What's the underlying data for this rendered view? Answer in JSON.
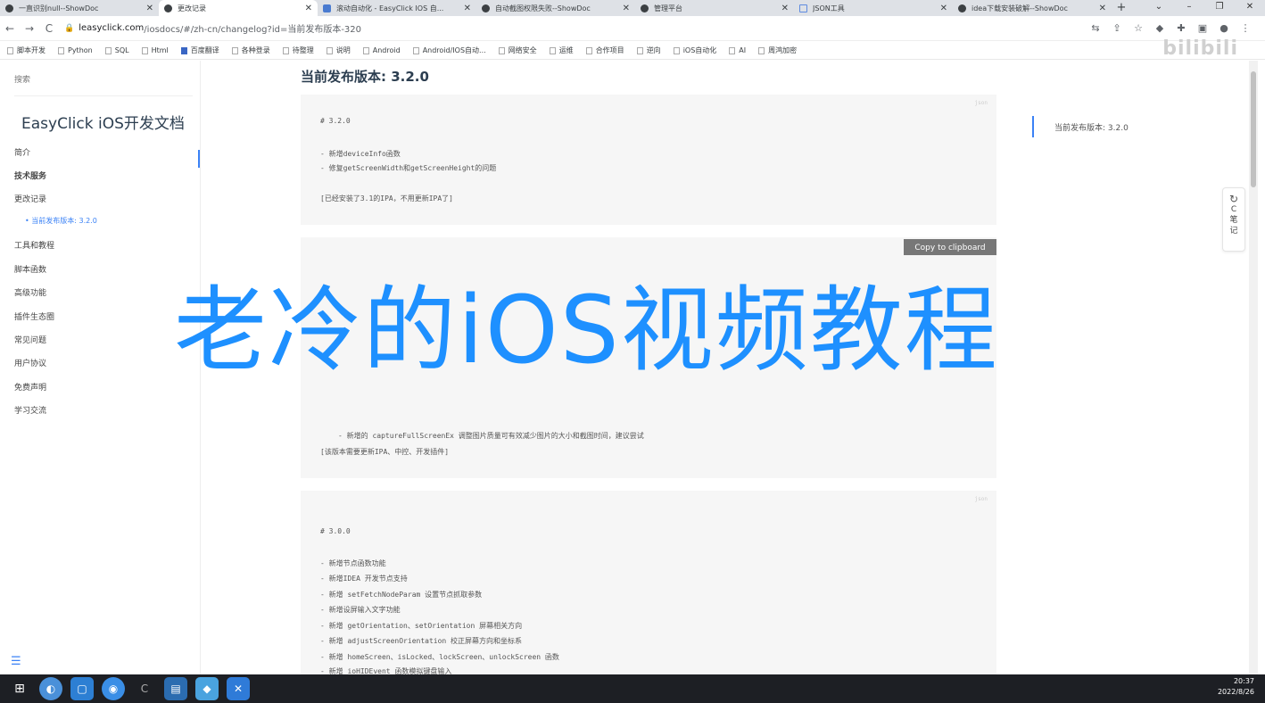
{
  "browser": {
    "tabs": [
      {
        "title": "一直识别null--ShowDoc",
        "icon": "showdoc-icon"
      },
      {
        "title": "更改记录",
        "icon": "showdoc-icon",
        "active": true
      },
      {
        "title": "滚动自动化 - EasyClick IOS 自...",
        "icon": "easyclick-icon"
      },
      {
        "title": "自动截图权限失败--ShowDoc",
        "icon": "showdoc-icon"
      },
      {
        "title": "管理平台",
        "icon": "showdoc-icon"
      },
      {
        "title": "JSON工具",
        "icon": "json-icon"
      },
      {
        "title": "idea下载安装破解--ShowDoc",
        "icon": "showdoc-icon"
      }
    ],
    "new_tab": "+",
    "url_host": "leasyclick.com",
    "url_path": "/iosdocs/#/zh-cn/changelog?id=当前发布版本-320",
    "bookmarks": [
      "脚本开发",
      "Python",
      "SQL",
      "Html",
      "百度翻译",
      "各种登录",
      "待整理",
      "说明",
      "Android",
      "Android/IOS自动...",
      "网络安全",
      "运维",
      "合作项目",
      "逆向",
      "iOS自动化",
      "AI",
      "周鸿加密"
    ],
    "watermark": "bilibili"
  },
  "sidebar": {
    "search_placeholder": "搜索",
    "brand": "EasyClick iOS开发文档",
    "items": [
      "简介",
      "技术服务",
      "更改记录",
      "• 当前发布版本: 3.2.0",
      "工具和教程",
      "脚本函数",
      "高级功能",
      "插件生态圈",
      "常见问题",
      "用户协议",
      "免费声明",
      "学习交流"
    ]
  },
  "main": {
    "heading": "当前发布版本: 3.2.0",
    "block1": {
      "lang": "json",
      "lines": [
        "# 3.2.0",
        "- 新增deviceInfo函数",
        "- 修复getScreenWidth和getScreenHeight的问题",
        "[已经安装了3.1的IPA，不用更新IPA了]"
      ]
    },
    "copy_button": "Copy to clipboard",
    "block2": {
      "lines": [
        "- 新增的 captureFullScreenEx 调整图片质量可有效减少图片的大小和截图时间，建议尝试",
        "[该版本需要更新IPA、中控、开发插件]"
      ]
    },
    "block3": {
      "lang": "json",
      "lines": [
        "# 3.0.0",
        "- 新增节点函数功能",
        "- 新增IDEA 开发节点支持",
        "- 新增 setFetchNodeParam 设置节点抓取参数",
        "- 新增设屏输入文字功能",
        "- 新增 getOrientation、setOrientation 屏幕相关方向",
        "- 新增 adjustScreenOrientation 校正屏幕方向和坐标系",
        "- 新增 homeScreen、isLocked、lockScreen、unlockScreen 函数",
        "- 新增 ioHIDEvent 函数模拟键盘输入"
      ]
    }
  },
  "toc": {
    "item": "当前发布版本: 3.2.0"
  },
  "note_button": {
    "letter": "C",
    "label1": "笔",
    "label2": "记"
  },
  "overlay_text": "老冷的iOS视频教程",
  "taskbar": {
    "time": "20:37",
    "date": "2022/8/26"
  }
}
